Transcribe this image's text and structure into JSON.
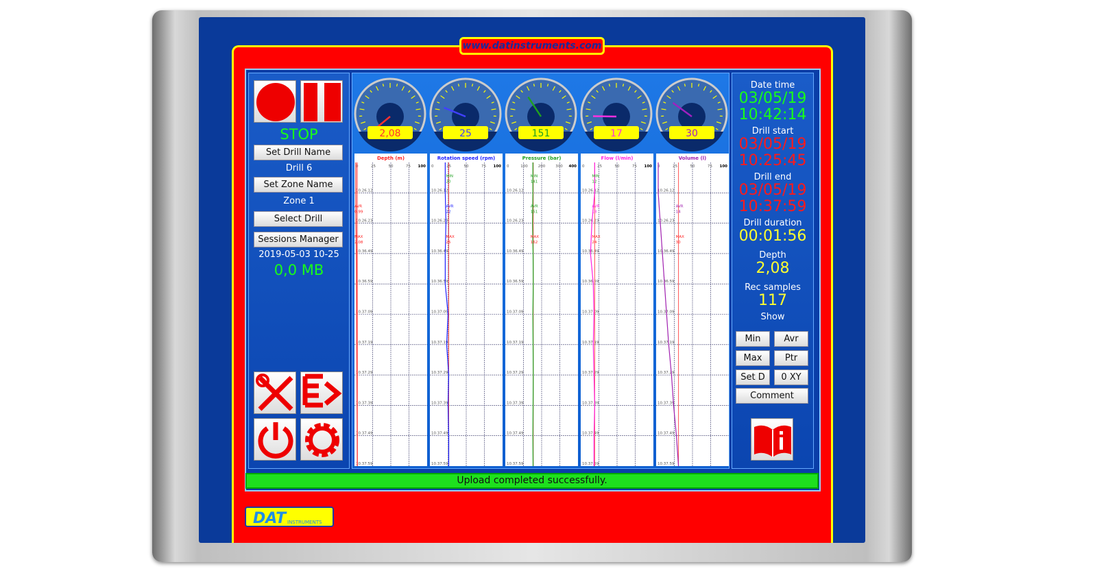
{
  "header": {
    "url": "www.datinstruments.com"
  },
  "left": {
    "state": "STOP",
    "set_drill_name": "Set Drill Name",
    "drill_name": "Drill 6",
    "set_zone_name": "Set Zone Name",
    "zone_name": "Zone 1",
    "select_drill": "Select Drill",
    "sessions_manager": "Sessions Manager",
    "session": "2019-05-03 10-25",
    "size": "0,0 MB"
  },
  "right": {
    "date_time_label": "Date time",
    "date": "03/05/19",
    "time": "10:42:14",
    "drill_start_label": "Drill start",
    "start_date": "03/05/19",
    "start_time": "10:25:45",
    "drill_end_label": "Drill end",
    "end_date": "03/05/19",
    "end_time": "10:37:59",
    "duration_label": "Drill duration",
    "duration": "00:01:56",
    "depth_label": "Depth",
    "depth": "2,08",
    "samples_label": "Rec samples",
    "samples": "117",
    "show_label": "Show",
    "buttons": [
      "Min",
      "Avr",
      "Max",
      "Ptr",
      "Set D",
      "0 XY",
      "Comment"
    ]
  },
  "status": "Upload completed successfully.",
  "logo": {
    "text": "DAT",
    "sub": "INSTRUMENTS"
  },
  "icons": [
    "record-icon",
    "pause-icon",
    "tools-icon",
    "export-icon",
    "power-icon",
    "settings-icon",
    "manual-icon"
  ],
  "gauges": [
    {
      "display": "2,08",
      "value": 2.08,
      "max": 100,
      "color": "#ff3030"
    },
    {
      "display": "25",
      "value": 25,
      "max": 100,
      "color": "#4040ff"
    },
    {
      "display": "151",
      "value": 151,
      "max": 400,
      "color": "#20a020"
    },
    {
      "display": "17",
      "value": 17,
      "max": 100,
      "color": "#ff30e0"
    },
    {
      "display": "30",
      "value": 30,
      "max": 100,
      "color": "#a020c0"
    }
  ],
  "chart_data": [
    {
      "type": "line",
      "title": "Depth (m)",
      "color": "#ff2020",
      "ticks": [
        "0",
        "25",
        "50",
        "75",
        "100"
      ],
      "xlim": [
        0,
        100
      ],
      "time": [
        "10.26.12",
        "10.26.23",
        "10.36.49",
        "10.36.59",
        "10.37.09",
        "10.37.19",
        "10.37.29",
        "10.37.39",
        "10.37.49",
        "10.37.59"
      ],
      "values": [
        0.1,
        0.3,
        0.8,
        1.0,
        1.2,
        1.4,
        1.6,
        1.8,
        2.0,
        2.08
      ],
      "annotations": [
        {
          "label": "AVR",
          "value": "0,99",
          "color": "#ff2020"
        },
        {
          "label": "MAX",
          "value": "2,08",
          "color": "#ff2020"
        }
      ]
    },
    {
      "type": "line",
      "title": "Rotation speed (rpm)",
      "color": "#2020ff",
      "ticks": [
        "0",
        "25",
        "50",
        "75",
        "100"
      ],
      "xlim": [
        0,
        100
      ],
      "time": [
        "10.26.12",
        "10.26.23",
        "10.36.49",
        "10.36.59",
        "10.37.09",
        "10.37.19",
        "10.37.29",
        "10.37.39",
        "10.37.49",
        "10.37.59"
      ],
      "values": [
        20,
        21,
        20,
        20,
        24,
        22,
        25,
        24,
        25,
        25
      ],
      "annotations": [
        {
          "label": "MIN",
          "value": "20",
          "color": "#20a020"
        },
        {
          "label": "AVR",
          "value": "22",
          "color": "#2020ff"
        },
        {
          "label": "MAX",
          "value": "25",
          "color": "#ff2020"
        }
      ]
    },
    {
      "type": "line",
      "title": "Pressure (bar)",
      "color": "#20a020",
      "ticks": [
        "0",
        "100",
        "200",
        "300",
        "400"
      ],
      "xlim": [
        0,
        400
      ],
      "time": [
        "10.26.12",
        "10.26.23",
        "10.36.49",
        "10.36.59",
        "10.37.09",
        "10.37.19",
        "10.37.29",
        "10.37.39",
        "10.37.49",
        "10.37.59"
      ],
      "values": [
        150,
        148,
        151,
        152,
        150,
        151,
        152,
        151,
        150,
        151
      ],
      "annotations": [
        {
          "label": "MIN",
          "value": "141",
          "color": "#20a020"
        },
        {
          "label": "AVR",
          "value": "151",
          "color": "#20a020"
        },
        {
          "label": "MAX",
          "value": "162",
          "color": "#ff2020"
        }
      ]
    },
    {
      "type": "line",
      "title": "Flow (l/min)",
      "color": "#ff20e0",
      "ticks": [
        "0",
        "25",
        "50",
        "75",
        "100"
      ],
      "xlim": [
        0,
        100
      ],
      "time": [
        "10.26.12",
        "10.26.23",
        "10.36.49",
        "10.36.59",
        "10.37.09",
        "10.37.19",
        "10.37.29",
        "10.37.39",
        "10.37.49",
        "10.37.59"
      ],
      "values": [
        18,
        14,
        12,
        16,
        17,
        16,
        17,
        18,
        17,
        17
      ],
      "annotations": [
        {
          "label": "MIN",
          "value": "12",
          "color": "#20a020"
        },
        {
          "label": "AVR",
          "value": "18",
          "color": "#ff20e0"
        },
        {
          "label": "MAX",
          "value": "24",
          "color": "#ff2020"
        }
      ]
    },
    {
      "type": "line",
      "title": "Volume (l)",
      "color": "#a020b0",
      "ticks": [
        "0",
        "25",
        "50",
        "75",
        "100"
      ],
      "xlim": [
        0,
        100
      ],
      "time": [
        "10.26.12",
        "10.26.23",
        "10.36.49",
        "10.36.59",
        "10.37.09",
        "10.37.19",
        "10.37.29",
        "10.37.39",
        "10.37.49",
        "10.37.59"
      ],
      "values": [
        1,
        4,
        7,
        10,
        13,
        16,
        20,
        23,
        27,
        30
      ],
      "annotations": [
        {
          "label": "AVR",
          "value": "14",
          "color": "#a020b0"
        },
        {
          "label": "MAX",
          "value": "30",
          "color": "#ff2020"
        }
      ]
    }
  ]
}
